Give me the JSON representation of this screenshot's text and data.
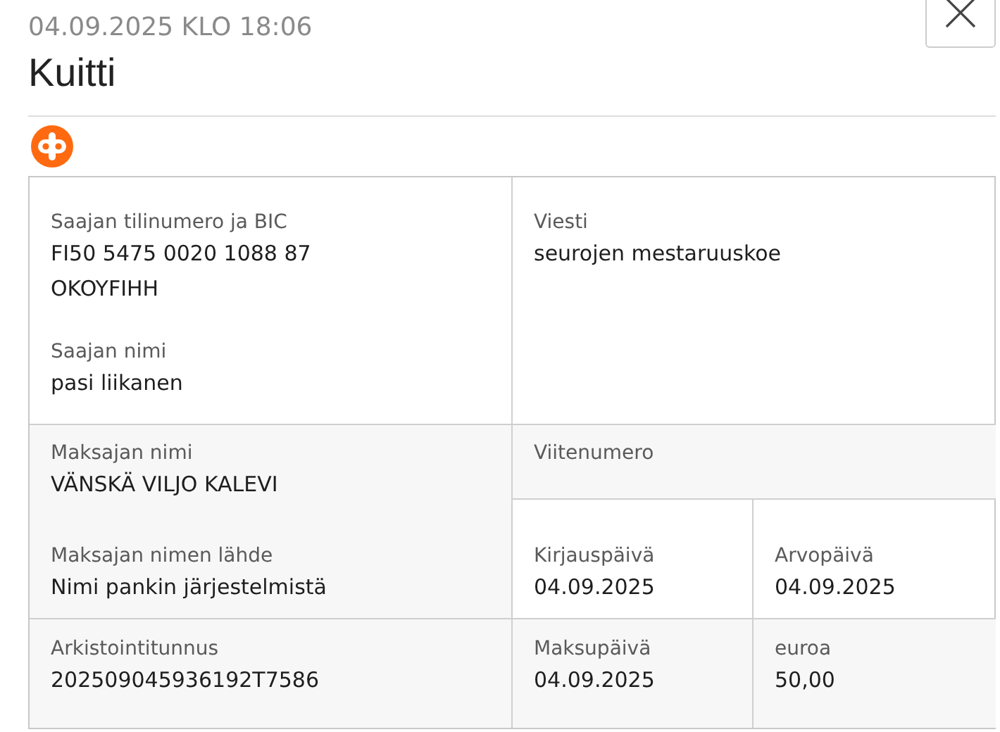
{
  "header": {
    "timestamp": "04.09.2025 KLO 18:06",
    "title": "Kuitti"
  },
  "receipt": {
    "recipient_account": {
      "label": "Saajan tilinumero ja BIC",
      "values": [
        "FI50 5475 0020 1088 87",
        "OKOYFIHH"
      ]
    },
    "recipient_name": {
      "label": "Saajan nimi",
      "values": [
        "pasi liikanen"
      ]
    },
    "message": {
      "label": "Viesti",
      "values": [
        "seurojen mestaruuskoe"
      ]
    },
    "payer_name": {
      "label": "Maksajan nimi",
      "values": [
        "VÄNSKÄ VILJO KALEVI"
      ]
    },
    "payer_name_source": {
      "label": "Maksajan nimen lähde",
      "values": [
        "Nimi pankin järjestelmistä"
      ]
    },
    "reference": {
      "label": "Viitenumero"
    },
    "booking_date": {
      "label": "Kirjauspäivä",
      "values": [
        "04.09.2025"
      ]
    },
    "value_date": {
      "label": "Arvopäivä",
      "values": [
        "04.09.2025"
      ]
    },
    "archive_id": {
      "label": "Arkistointitunnus",
      "values": [
        "202509045936192T7586"
      ]
    },
    "payment_date": {
      "label": "Maksupäivä",
      "values": [
        "04.09.2025"
      ]
    },
    "amount": {
      "label": "euroa",
      "values": [
        "50,00"
      ]
    }
  }
}
